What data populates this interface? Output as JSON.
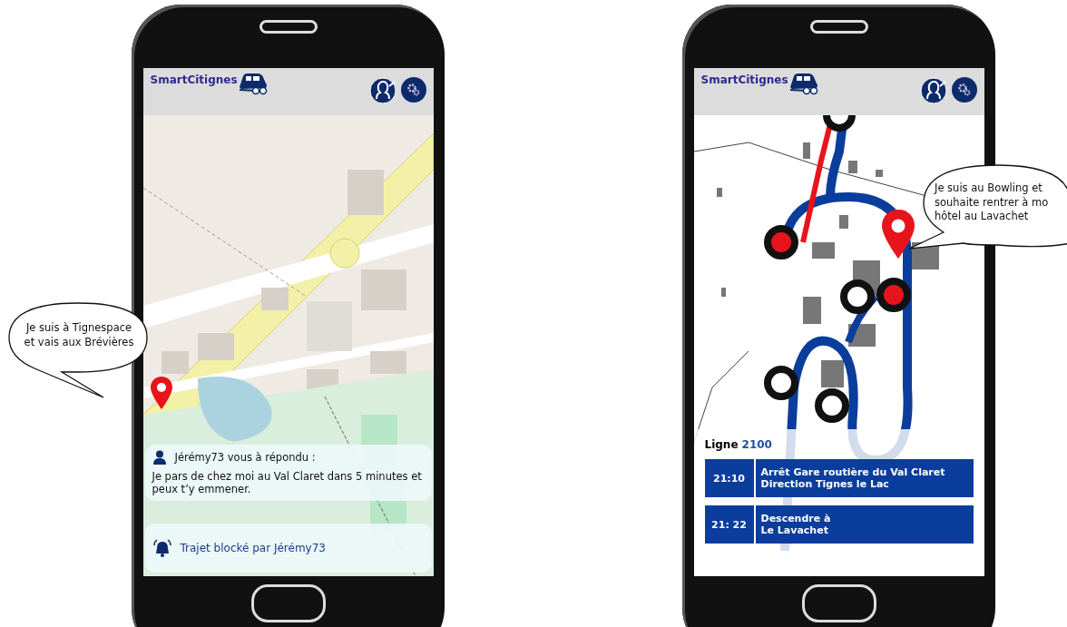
{
  "phones": [
    {
      "kind": "map",
      "app_name": "SmartCitignes",
      "bubble": "Je suis à Tignespace\net vais aux Brévières",
      "message": {
        "author": "Jérémy73 vous à répondu :",
        "body": "Je pars de chez moi au Val Claret dans 5 minutes et peux t’y emmener."
      },
      "alert": "Trajet blocké par Jérémy73"
    },
    {
      "kind": "route",
      "app_name": "SmartCitignes",
      "bubble": "Je suis au Bowling et\nsouhaite rentrer à mo\nhôtel au Lavachet",
      "line_label": "Ligne",
      "line_number": "2100",
      "steps": [
        {
          "time": "21:10",
          "text": "Arrêt Gare routière du Val Claret\nDirection Tignes le Lac"
        },
        {
          "time": "21: 22",
          "text": "Descendre à\nLe Lavachet"
        }
      ]
    }
  ]
}
